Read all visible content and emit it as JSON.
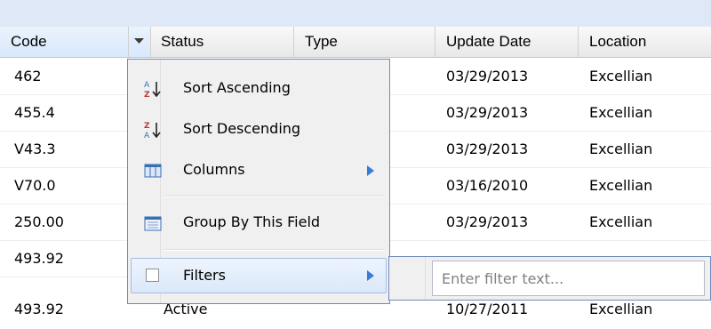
{
  "grid": {
    "columns": [
      "Code",
      "Status",
      "Type",
      "Update Date",
      "Location"
    ],
    "rows": [
      {
        "code": "462",
        "update_date": "03/29/2013",
        "location": "Excellian"
      },
      {
        "code": "455.4",
        "update_date": "03/29/2013",
        "location": "Excellian"
      },
      {
        "code": "V43.3",
        "update_date": "03/29/2013",
        "location": "Excellian"
      },
      {
        "code": "V70.0",
        "update_date": "03/16/2010",
        "location": "Excellian"
      },
      {
        "code": "250.00",
        "update_date": "03/29/2013",
        "location": "Excellian"
      },
      {
        "code": "493.92",
        "update_date": "",
        "location": ""
      }
    ],
    "partial_row": {
      "code": "493.92",
      "status": "Active",
      "update_date": "10/27/2011",
      "location": "Excellian"
    }
  },
  "column_menu": {
    "sort_ascending": "Sort Ascending",
    "sort_descending": "Sort Descending",
    "columns": "Columns",
    "group_by": "Group By This Field",
    "filters": "Filters"
  },
  "filter_submenu": {
    "placeholder": "Enter filter text...",
    "value": ""
  },
  "colors": {
    "header_active": "#d9e8fb",
    "menu_border": "#718bb7",
    "hover_border": "#a3bde3",
    "icon_blue": "#3a6fb5"
  },
  "icons": [
    "sort-ascending-icon",
    "sort-descending-icon",
    "columns-icon",
    "group-by-icon",
    "submenu-arrow-icon",
    "dropdown-trigger-icon"
  ]
}
